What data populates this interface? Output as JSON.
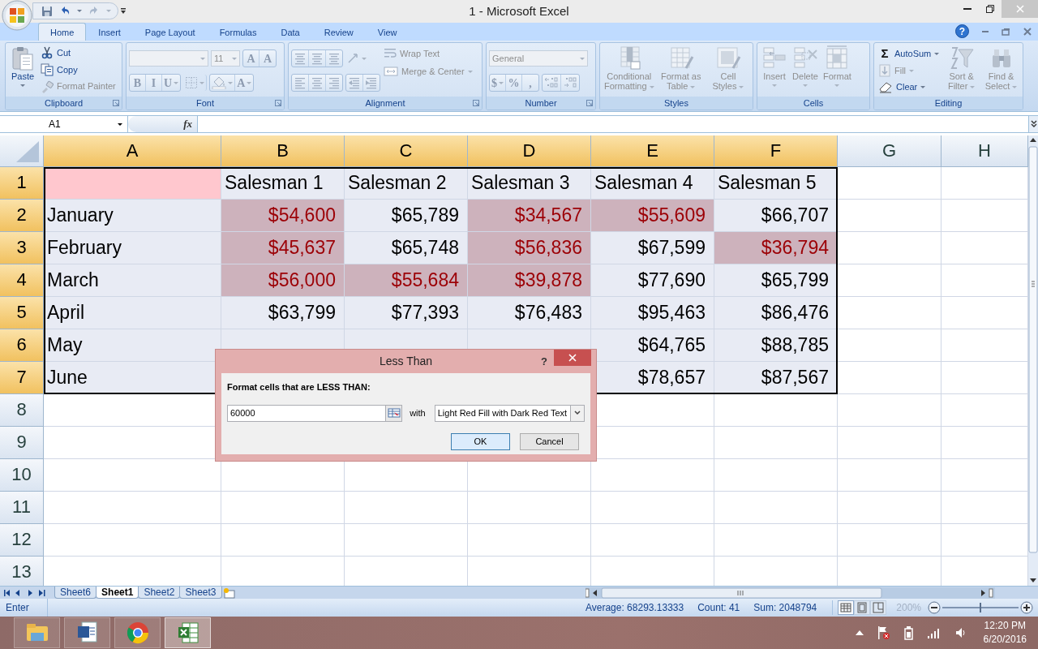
{
  "window": {
    "title": "1 - Microsoft Excel"
  },
  "ribbon_tabs": [
    {
      "label": "Home",
      "selected": true
    },
    {
      "label": "Insert",
      "selected": false
    },
    {
      "label": "Page Layout",
      "selected": false
    },
    {
      "label": "Formulas",
      "selected": false
    },
    {
      "label": "Data",
      "selected": false
    },
    {
      "label": "Review",
      "selected": false
    },
    {
      "label": "View",
      "selected": false
    }
  ],
  "help": "?",
  "ribbon_groups": [
    {
      "label": "Clipboard",
      "launcher": true,
      "columns": [
        [
          {
            "kind": "large",
            "label": "Paste",
            "disabled": false,
            "dropdown": true
          }
        ],
        [
          {
            "kind": "small",
            "label": "Cut",
            "disabled": false
          },
          {
            "kind": "small",
            "label": "Copy",
            "disabled": false
          },
          {
            "kind": "small",
            "label": "Format Painter",
            "disabled": true
          }
        ]
      ]
    },
    {
      "label": "Font",
      "launcher": true,
      "columns": [
        [
          {
            "kind": "strip",
            "segments": [
              {
                "kind": "combo",
                "disabled": true
              },
              {
                "kind": "combo",
                "value": "11",
                "disabled": true
              },
              {
                "kind": "group",
                "buttons": [
                  {
                    "label": "A",
                    "disabled": true
                  },
                  {
                    "label": "A",
                    "disabled": true
                  }
                ]
              }
            ]
          },
          {
            "kind": "strip",
            "segments": [
              {
                "kind": "group",
                "buttons": [
                  {
                    "label": "B",
                    "disabled": true
                  },
                  {
                    "label": "I",
                    "disabled": true
                  },
                  {
                    "label": "U",
                    "disabled": true,
                    "dropdown": true
                  }
                ]
              },
              {
                "kind": "group",
                "buttons": [
                  {
                    "disabled": true,
                    "dropdown": true
                  }
                ]
              },
              {
                "kind": "group",
                "buttons": [
                  {
                    "disabled": true,
                    "dropdown": true
                  },
                  {
                    "label": "A",
                    "disabled": true,
                    "dropdown": true
                  }
                ]
              }
            ]
          }
        ]
      ]
    },
    {
      "label": "Alignment",
      "launcher": true,
      "columns": [
        [
          {
            "kind": "strip",
            "segments": [
              {
                "kind": "group",
                "buttons": [
                  {
                    "disabled": true
                  },
                  {
                    "disabled": true
                  },
                  {
                    "disabled": true
                  }
                ]
              },
              {
                "kind": "group",
                "buttons": [
                  {
                    "disabled": true,
                    "dropdown": true
                  }
                ]
              }
            ]
          },
          {
            "kind": "strip",
            "segments": [
              {
                "kind": "group",
                "buttons": [
                  {
                    "disabled": true
                  },
                  {
                    "disabled": true
                  },
                  {
                    "disabled": true
                  }
                ]
              },
              {
                "kind": "group",
                "buttons": [
                  {
                    "disabled": true
                  },
                  {
                    "disabled": true
                  }
                ]
              }
            ]
          }
        ],
        [
          {
            "kind": "small",
            "label": "Wrap Text",
            "disabled": true
          },
          {
            "kind": "small",
            "label": "Merge & Center",
            "disabled": true,
            "dropdown": true
          }
        ]
      ]
    },
    {
      "label": "Number",
      "launcher": true,
      "columns": [
        [
          {
            "kind": "strip",
            "segments": [
              {
                "kind": "combo",
                "value": "General",
                "disabled": true
              }
            ]
          },
          {
            "kind": "strip",
            "segments": [
              {
                "kind": "group",
                "buttons": [
                  {
                    "label": "$",
                    "disabled": true,
                    "dropdown": true
                  },
                  {
                    "label": "%",
                    "disabled": true
                  },
                  {
                    "label": ",",
                    "disabled": true
                  }
                ]
              },
              {
                "kind": "group",
                "buttons": [
                  {
                    "disabled": true
                  },
                  {
                    "disabled": true
                  }
                ]
              }
            ]
          }
        ]
      ]
    },
    {
      "label": "Styles",
      "columns": [
        [
          {
            "kind": "large",
            "label": "Conditional Formatting",
            "disabled": true,
            "dropdown": true
          }
        ],
        [
          {
            "kind": "large",
            "label": "Format as Table",
            "disabled": true,
            "dropdown": true
          }
        ],
        [
          {
            "kind": "large",
            "label": "Cell Styles",
            "disabled": true,
            "dropdown": true
          }
        ]
      ]
    },
    {
      "label": "Cells",
      "columns": [
        [
          {
            "kind": "large",
            "label": "Insert",
            "disabled": true,
            "dropdown": true
          }
        ],
        [
          {
            "kind": "large",
            "label": "Delete",
            "disabled": true,
            "dropdown": true
          }
        ],
        [
          {
            "kind": "large",
            "label": "Format",
            "disabled": true,
            "dropdown": true
          }
        ]
      ]
    },
    {
      "label": "Editing",
      "columns": [
        [
          {
            "kind": "small",
            "glyph": "Σ",
            "label": "AutoSum",
            "disabled": false,
            "dropdown": true
          },
          {
            "kind": "small",
            "label": "Fill",
            "disabled": true,
            "dropdown": true
          },
          {
            "kind": "small",
            "label": "Clear",
            "disabled": false,
            "dropdown": true
          }
        ],
        [
          {
            "kind": "large",
            "label": "Sort & Filter",
            "disabled": true,
            "dropdown": true
          }
        ],
        [
          {
            "kind": "large",
            "label": "Find & Select",
            "disabled": true,
            "dropdown": true
          }
        ]
      ]
    }
  ],
  "name_box": "A1",
  "fx": "fx",
  "columns": [
    {
      "label": "A",
      "selected": true
    },
    {
      "label": "B",
      "selected": true
    },
    {
      "label": "C",
      "selected": true
    },
    {
      "label": "D",
      "selected": true
    },
    {
      "label": "E",
      "selected": true
    },
    {
      "label": "F",
      "selected": true
    },
    {
      "label": "G",
      "selected": false
    },
    {
      "label": "H",
      "selected": false
    }
  ],
  "rows": [
    {
      "label": "1",
      "selected": true,
      "cells": [
        {
          "highlighted": true,
          "selected": false
        },
        {
          "text": "Salesman 1",
          "highlighted": false,
          "selected": true
        },
        {
          "text": "Salesman 2",
          "highlighted": false,
          "selected": true
        },
        {
          "text": "Salesman 3",
          "highlighted": false,
          "selected": true
        },
        {
          "text": "Salesman 4",
          "highlighted": false,
          "selected": true
        },
        {
          "text": "Salesman 5",
          "highlighted": false,
          "selected": true
        }
      ]
    },
    {
      "label": "2",
      "selected": true,
      "cells": [
        {
          "text": "January",
          "highlighted": false,
          "selected": true
        },
        {
          "text": "$54,600",
          "highlighted": true,
          "selected": true
        },
        {
          "text": "$65,789",
          "highlighted": false,
          "selected": true
        },
        {
          "text": "$34,567",
          "highlighted": true,
          "selected": true
        },
        {
          "text": "$55,609",
          "highlighted": true,
          "selected": true
        },
        {
          "text": "$66,707",
          "highlighted": false,
          "selected": true
        }
      ]
    },
    {
      "label": "3",
      "selected": true,
      "cells": [
        {
          "text": "February",
          "highlighted": false,
          "selected": true
        },
        {
          "text": "$45,637",
          "highlighted": true,
          "selected": true
        },
        {
          "text": "$65,748",
          "highlighted": false,
          "selected": true
        },
        {
          "text": "$56,836",
          "highlighted": true,
          "selected": true
        },
        {
          "text": "$67,599",
          "highlighted": false,
          "selected": true
        },
        {
          "text": "$36,794",
          "highlighted": true,
          "selected": true
        }
      ]
    },
    {
      "label": "4",
      "selected": true,
      "cells": [
        {
          "text": "March",
          "highlighted": false,
          "selected": true
        },
        {
          "text": "$56,000",
          "highlighted": true,
          "selected": true
        },
        {
          "text": "$55,684",
          "highlighted": true,
          "selected": true
        },
        {
          "text": "$39,878",
          "highlighted": true,
          "selected": true
        },
        {
          "text": "$77,690",
          "highlighted": false,
          "selected": true
        },
        {
          "text": "$65,799",
          "highlighted": false,
          "selected": true
        }
      ]
    },
    {
      "label": "5",
      "selected": true,
      "cells": [
        {
          "text": "April",
          "highlighted": false,
          "selected": true
        },
        {
          "text": "$63,799",
          "highlighted": false,
          "selected": true
        },
        {
          "text": "$77,393",
          "highlighted": false,
          "selected": true
        },
        {
          "text": "$76,483",
          "highlighted": false,
          "selected": true
        },
        {
          "text": "$95,463",
          "highlighted": false,
          "selected": true
        },
        {
          "text": "$86,476",
          "highlighted": false,
          "selected": true
        }
      ]
    },
    {
      "label": "6",
      "selected": true,
      "cells": [
        {
          "text": "May",
          "highlighted": false,
          "selected": true
        },
        {
          "highlighted": false,
          "selected": true
        },
        {
          "highlighted": false,
          "selected": true
        },
        {
          "highlighted": false,
          "selected": true
        },
        {
          "text": "$64,765",
          "highlighted": false,
          "selected": true
        },
        {
          "text": "$88,785",
          "highlighted": false,
          "selected": true
        }
      ]
    },
    {
      "label": "7",
      "selected": true,
      "cells": [
        {
          "text": "June",
          "highlighted": false,
          "selected": true
        },
        null,
        null,
        null,
        {
          "text": "$78,657",
          "highlighted": false,
          "selected": true
        },
        {
          "text": "$87,567",
          "highlighted": false,
          "selected": true
        }
      ]
    },
    {
      "label": "8",
      "selected": false
    },
    {
      "label": "9",
      "selected": false
    },
    {
      "label": "10",
      "selected": false
    },
    {
      "label": "11",
      "selected": false
    },
    {
      "label": "12",
      "selected": false
    },
    {
      "label": "13",
      "selected": false
    }
  ],
  "sheet_tabs": [
    {
      "label": "Sheet6",
      "selected": false
    },
    {
      "label": "Sheet1",
      "selected": true
    },
    {
      "label": "Sheet2",
      "selected": false
    },
    {
      "label": "Sheet3",
      "selected": false
    }
  ],
  "status_bar": {
    "mode": "Enter",
    "average": "Average: 68293.13333",
    "count": "Count: 41",
    "sum": "Sum: 2048794",
    "views": [
      {
        "selected": true
      },
      {
        "selected": false
      },
      {
        "selected": false
      }
    ],
    "zoom": {
      "label": "200%",
      "level": 0.5
    }
  },
  "dialog": {
    "title": "Less Than",
    "help": "?",
    "prompt": "Format cells that are LESS THAN:",
    "value": "60000",
    "with": "with",
    "format": "Light Red Fill with Dark Red Text",
    "buttons": [
      {
        "label": "OK",
        "default": true
      },
      {
        "label": "Cancel",
        "default": false
      }
    ]
  },
  "taskbar": {
    "apps": [
      {
        "selected": false
      },
      {
        "selected": false
      },
      {
        "selected": false
      },
      {
        "selected": true
      }
    ],
    "time": "12:20 PM",
    "date": "6/20/2016"
  }
}
